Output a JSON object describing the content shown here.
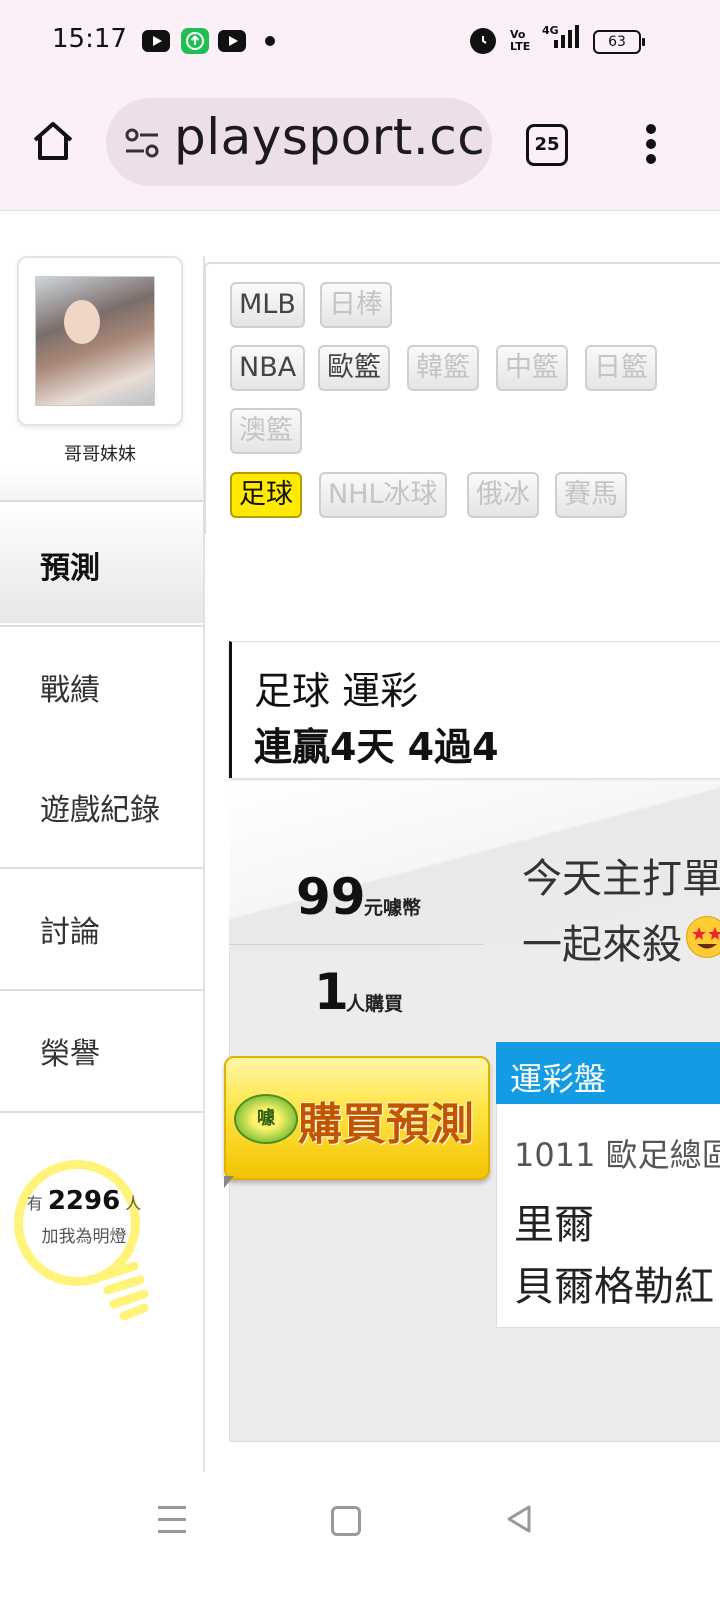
{
  "status_bar": {
    "time": "15:17",
    "battery": "63",
    "network_label": "4G",
    "volte_label": "Vo LTE",
    "icons": [
      "youtube-icon",
      "green-app-icon",
      "youtube-icon",
      "notification-dot-icon",
      "alarm-icon",
      "volte-icon",
      "signal-icon",
      "battery-icon"
    ]
  },
  "browser": {
    "url": "playsport.cc",
    "tab_count": "25",
    "icons": [
      "home-icon",
      "site-settings-icon",
      "tabs-icon",
      "more-menu-icon"
    ]
  },
  "profile": {
    "username": "哥哥妹妹"
  },
  "sidebar": {
    "items": [
      {
        "label": "預測",
        "active": true
      },
      {
        "label": "戰績"
      },
      {
        "label": "遊戲紀錄"
      },
      {
        "label": "討論"
      },
      {
        "label": "榮譽"
      }
    ],
    "fans": {
      "prefix": "有",
      "count": "2296",
      "suffix": "人",
      "caption": "加我為明燈"
    }
  },
  "categories": {
    "tags": [
      {
        "label": "MLB",
        "state": "on"
      },
      {
        "label": "日棒",
        "state": "off"
      },
      {
        "label": "NBA",
        "state": "on"
      },
      {
        "label": "歐籃",
        "state": "on"
      },
      {
        "label": "韓籃",
        "state": "off"
      },
      {
        "label": "中籃",
        "state": "off"
      },
      {
        "label": "日籃",
        "state": "off"
      },
      {
        "label": "澳籃",
        "state": "off"
      },
      {
        "label": "足球",
        "state": "selected"
      },
      {
        "label": "NHL冰球",
        "state": "off"
      },
      {
        "label": "俄冰",
        "state": "off"
      },
      {
        "label": "賽馬",
        "state": "off"
      }
    ]
  },
  "prediction": {
    "title": "足球 運彩",
    "streak": "連贏4天 4過4",
    "price": "99",
    "price_unit": "元噱幣",
    "buyers": "1",
    "buyers_unit": "人購買",
    "headline_line1": "今天主打單",
    "headline_line2": "一起來殺",
    "buy_button_label": "購買預測",
    "buy_coin_label": "噱",
    "market": {
      "header": "運彩盤",
      "game": "1011 歐足總區",
      "team1": "里爾",
      "team2": "貝爾格勒紅"
    }
  },
  "colors": {
    "browser_bar": "#fbf0f8",
    "selected_tag": "#ffea00",
    "market_header": "#139be3",
    "buy_button": "#ffe64a"
  }
}
